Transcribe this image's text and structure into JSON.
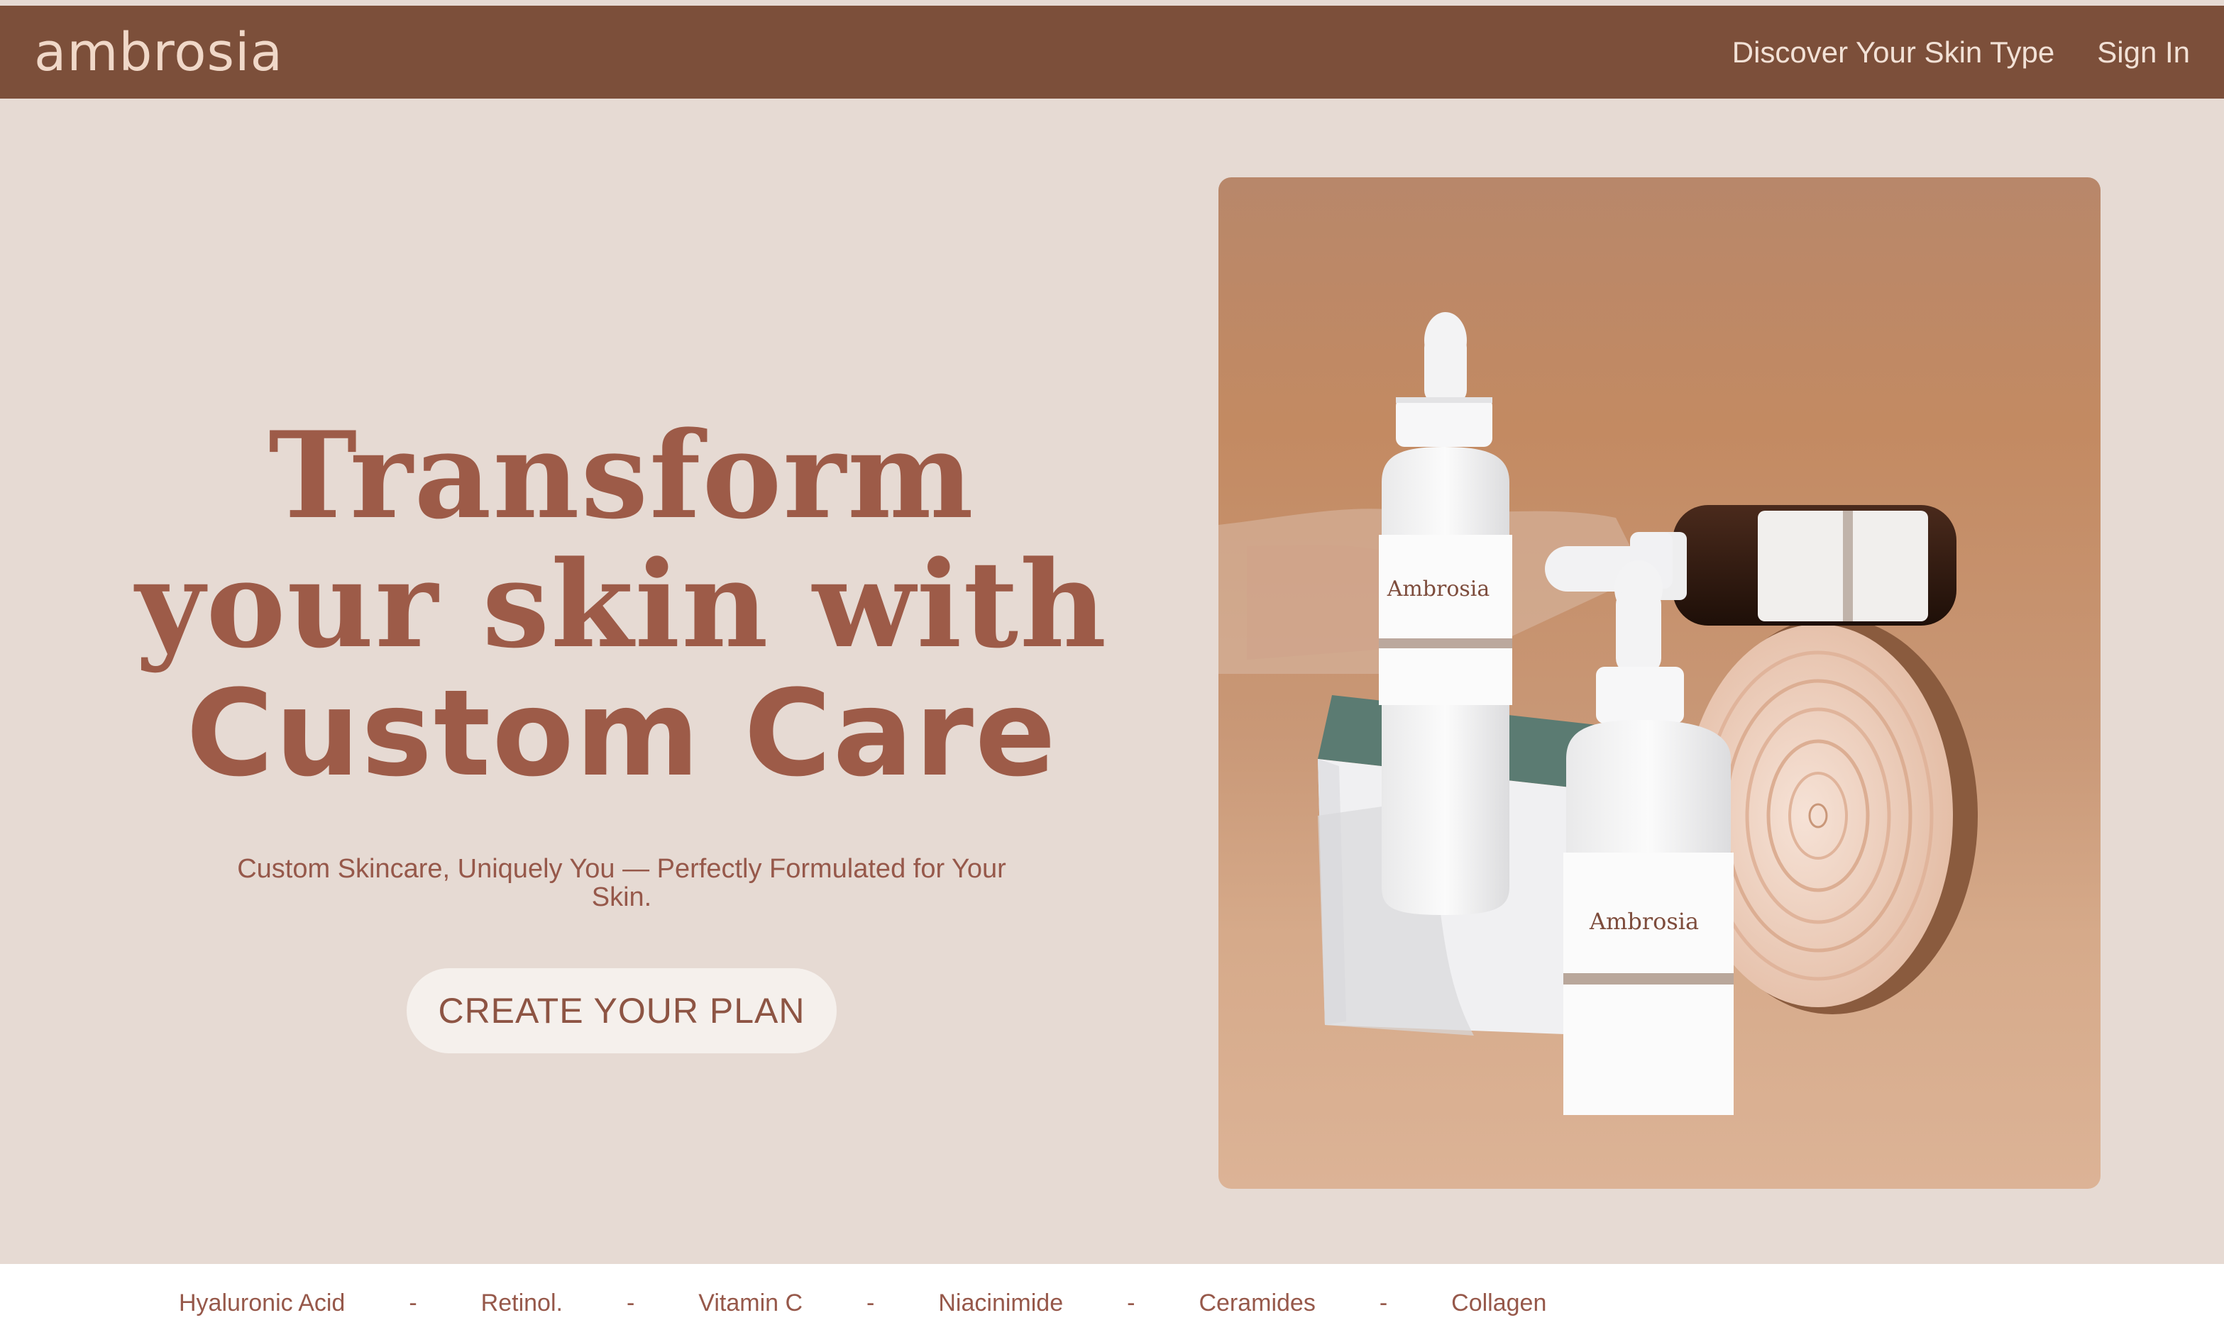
{
  "brand": {
    "logo_text": "ambrosia"
  },
  "nav": {
    "discover_label": "Discover Your Skin Type",
    "signin_label": "Sign In"
  },
  "hero": {
    "headline_line1": "Transform",
    "headline_line2": "your skin with",
    "headline_line3": "Custom Care",
    "subtitle": "Custom Skincare, Uniquely You — Perfectly Formulated for Your Skin.",
    "cta_label": "CREATE YOUR PLAN"
  },
  "photo": {
    "bottle_label_1": "Ambrosia",
    "bottle_label_2": "Ambrosia"
  },
  "ingredients": {
    "items": [
      "Hyaluronic Acid",
      "Retinol.",
      "Vitamin C",
      "Niacinimide",
      "Ceramides",
      "Collagen"
    ],
    "separator": "-"
  },
  "colors": {
    "nav_bg": "#7c4f3a",
    "page_bg": "#e6dad3",
    "accent": "#9d5b48",
    "cta_bg": "#f5f0ec"
  }
}
